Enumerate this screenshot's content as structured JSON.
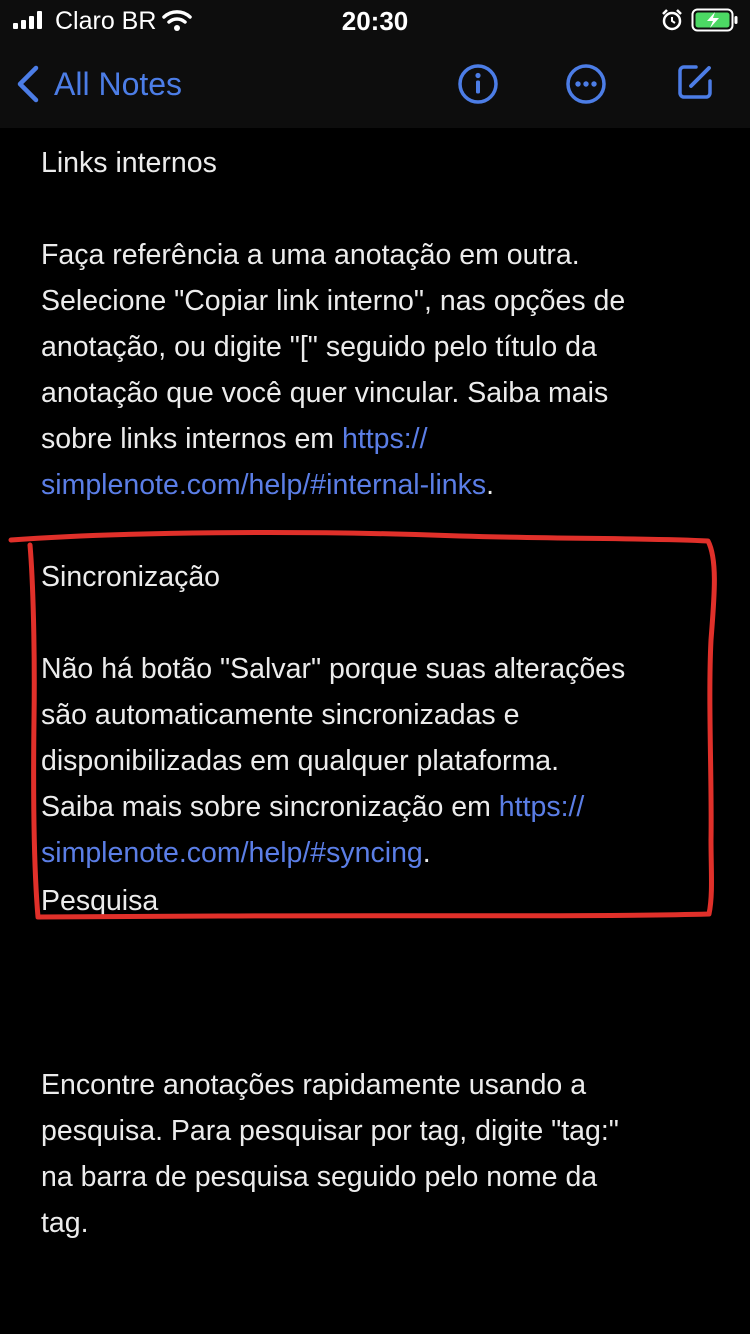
{
  "status_bar": {
    "carrier": "Claro BR",
    "time": "20:30"
  },
  "nav": {
    "back_label": "All Notes",
    "icons": [
      "chevron-left-icon",
      "info-icon",
      "more-icon",
      "compose-icon"
    ],
    "accent_color": "#4c7de6"
  },
  "note": {
    "section1_title": "Links internos",
    "section1_line1": "Faça referência a uma anotação em outra.",
    "section1_line2": "Selecione \"Copiar link interno\", nas opções de",
    "section1_line3": "anotação, ou digite \"[\" seguido pelo título da",
    "section1_line4": "anotação que você quer vincular. Saiba mais",
    "section1_line5_text": "sobre links internos em ",
    "section1_link_part1": "https://",
    "section1_link_part2": "simplenote.com/help/#internal-links",
    "section1_end": ".",
    "section2_title": "Sincronização",
    "section2_line1": "Não há botão \"Salvar\" porque suas alterações",
    "section2_line2": "são automaticamente sincronizadas e",
    "section2_line3": "disponibilizadas em qualquer plataforma.",
    "section2_line4_text": "Saiba mais sobre sincronização em ",
    "section2_link_part1": "https://",
    "section2_link_part2": "simplenote.com/help/#syncing",
    "section2_end": ".",
    "section3_title": "Pesquisa",
    "section3_line1": "Encontre anotações rapidamente usando a",
    "section3_line2": "pesquisa. Para pesquisar por tag, digite \"tag:\"",
    "section3_line3": "na barra de pesquisa seguido pelo nome da",
    "section3_line4": "tag.",
    "link_color": "#5b7ee6"
  },
  "annotation": {
    "color": "#e0302a"
  }
}
